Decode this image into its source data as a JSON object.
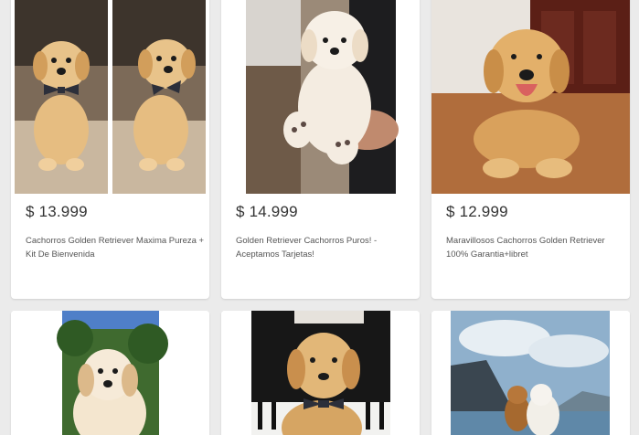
{
  "listings": [
    {
      "price": "$ 13.999",
      "title": "Cachorros Golden Retriever Maxima Pureza + Kit De Bienvenida"
    },
    {
      "price": "$ 14.999",
      "title": "Golden Retriever Cachorros Puros! - Aceptamos Tarjetas!"
    },
    {
      "price": "$ 12.999",
      "title": "Maravillosos Cachorros Golden Retriever 100% Garantia+libret"
    },
    {
      "price": "",
      "title": ""
    },
    {
      "price": "",
      "title": ""
    },
    {
      "price": "",
      "title": ""
    }
  ],
  "colors": {
    "page_bg": "#ebebeb",
    "card_bg": "#ffffff",
    "price_text": "#333333",
    "title_text": "#555555",
    "puppy_fur": "#e2b778",
    "bow_tie": "#2c2f3a"
  }
}
